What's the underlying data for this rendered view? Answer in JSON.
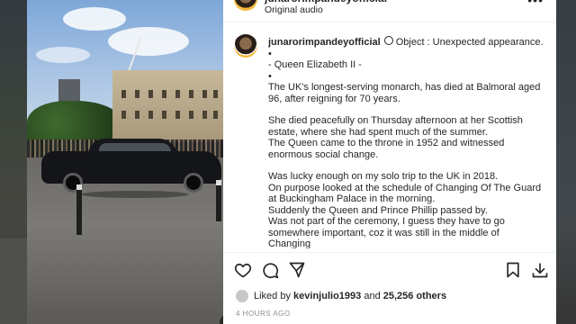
{
  "header": {
    "username": "junarorimpandeyofficial",
    "audio_label": "Original audio",
    "more_symbol": "•••"
  },
  "caption": {
    "username": "junarorimpandeyofficial",
    "lines": [
      "Object : Unexpected appearance.",
      "•",
      "- Queen Elizabeth II -",
      "•",
      "The UK's longest-serving monarch, has died at Balmoral aged 96, after reigning for 70 years.",
      "",
      "She died peacefully on Thursday afternoon at her Scottish estate, where she had spent much of the summer.",
      "The Queen came to the throne in 1952 and witnessed enormous social change.",
      "",
      "Was lucky enough on my solo trip to the UK in 2018.",
      "On purpose looked at the schedule of Changing Of The Guard at Buckingham Palace in the morning.",
      "Suddenly the Queen and Prince Phillip passed by.",
      "Was not part of the ceremony, I guess they have to go somewhere important, coz it was still in the middle of Changing"
    ]
  },
  "likes": {
    "prefix": "Liked by",
    "first_user": "kevinjulio1993",
    "joiner": "and",
    "others": "25,256 others"
  },
  "timestamp": "4 HOURS AGO",
  "icons": [
    "more-options-icon",
    "heart-icon",
    "comment-icon",
    "share-icon",
    "bookmark-icon",
    "download-icon",
    "pause-icon"
  ]
}
